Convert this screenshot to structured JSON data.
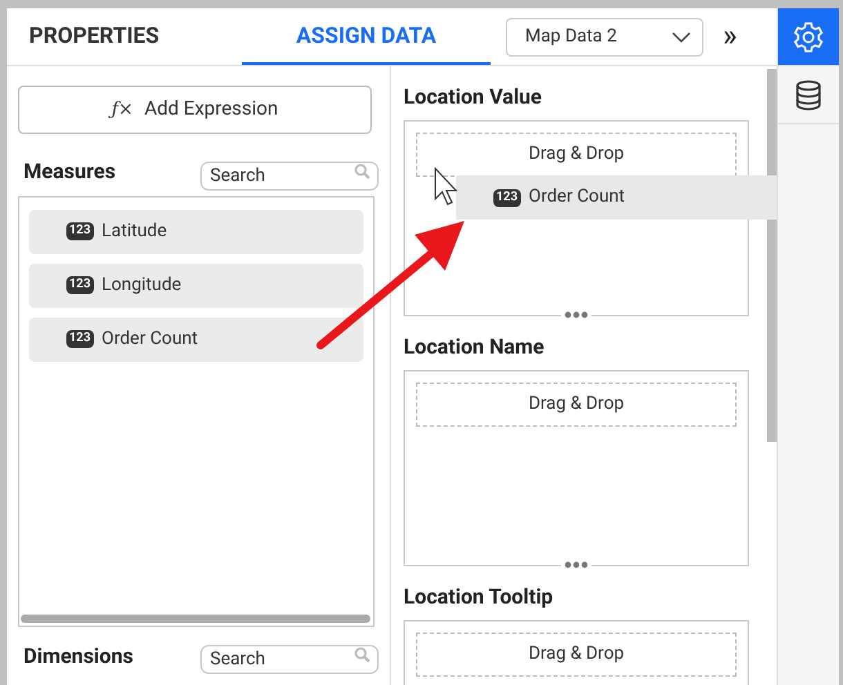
{
  "tabs": [
    {
      "label": "PROPERTIES",
      "selected": false
    },
    {
      "label": "ASSIGN DATA",
      "selected": true
    }
  ],
  "dropdown": {
    "value": "Map Data 2"
  },
  "collapse_glyph": "»",
  "side_icons": [
    {
      "kind": "settings",
      "selected": true
    },
    {
      "kind": "database",
      "selected": false
    }
  ],
  "add_expression": {
    "icon": "ƒ×",
    "label": "Add Expression"
  },
  "measures": {
    "title": "Measures",
    "search": {
      "placeholder": "Search"
    },
    "items": [
      {
        "badge": "123",
        "label": "Latitude"
      },
      {
        "badge": "123",
        "label": "Longitude"
      },
      {
        "badge": "123",
        "label": "Order Count"
      }
    ]
  },
  "dimensions": {
    "title": "Dimensions",
    "search": {
      "placeholder": "Search"
    }
  },
  "drop_sections": [
    {
      "title": "Location Value",
      "placeholder": "Drag & Drop"
    },
    {
      "title": "Location Name",
      "placeholder": "Drag & Drop"
    },
    {
      "title": "Location Tooltip",
      "placeholder": "Drag & Drop"
    }
  ],
  "drag_item": {
    "badge": "123",
    "label": "Order Count"
  }
}
